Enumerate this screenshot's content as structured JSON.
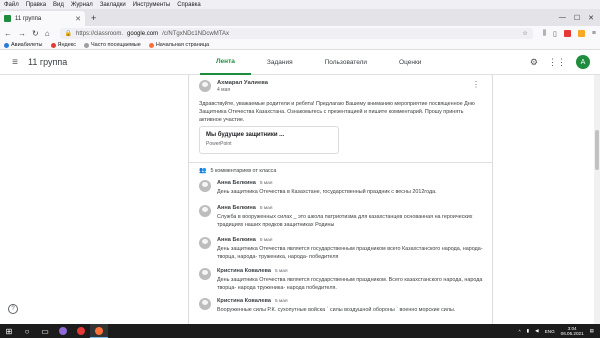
{
  "browser": {
    "menu": [
      "Файл",
      "Правка",
      "Вид",
      "Журнал",
      "Закладки",
      "Инструменты",
      "Справка"
    ],
    "tab_title": "11 группа",
    "url_prefix": "https://classroom.",
    "url_host": "google.com",
    "url_rest": "/c/NTgxNDc1NDcwMTAx",
    "bookmarks": [
      {
        "label": "Авиабилеты",
        "color": "#2b7bd6"
      },
      {
        "label": "Яндекс",
        "color": "#e53935"
      },
      {
        "label": "Часто посещаемые",
        "color": "#9e9e9e"
      },
      {
        "label": "Начальная страница",
        "color": "#ff7139"
      }
    ]
  },
  "classroom": {
    "class_name": "11 группа",
    "tabs": [
      "Лента",
      "Задания",
      "Пользователи",
      "Оценки"
    ],
    "active_tab": "Лента",
    "avatar_letter": "A",
    "accent": "#1e8e3e"
  },
  "post": {
    "author": "Ахмарал Уалиева",
    "date": "4 мая",
    "text": "Здравствуйте, уважаемые родители и ребята! Предлагаю Вашему вниманию мероприятие посвященное Дню Защитника Отечества Казахстана. Ознакомьтесь с презентацией и пишите комментарий. Прошу принять активное участие.",
    "attachment_title": "Мы будущие защитники ...",
    "attachment_type": "PowerPoint",
    "comments_count": "5 комментариев от класса"
  },
  "comments": [
    {
      "author": "Анна Белкина",
      "date": "5 мая",
      "text": "День защитника Отечества  в Казахстане, государственный праздник  с весны  2012года."
    },
    {
      "author": "Анна Белкина",
      "date": "5 мая",
      "text": "Служба  в вооруженных  силах _ это школа  патриотизма для казахстанцев основанная на героических традициях наших предков защитниках Родины"
    },
    {
      "author": "Анна Белкина",
      "date": "5 мая",
      "text": "День защитника Отечества является государственным праздником всего Казахстанского народа, народа- творца, народа- труженика, народа- победителя"
    },
    {
      "author": "Кристина Ковалева",
      "date": "5 мая",
      "text": "День защитника Отечества является государственным праздником.  Всего казахстанского народа, народа творца- народа труженика- народа победителя."
    },
    {
      "author": "Кристина Ковалева",
      "date": "5 мая",
      "text": "Вооруженные силы Р.К. сухопутные войска ` силы воздушной обороны ` военно морские силы."
    }
  ],
  "taskbar": {
    "time": "3:04",
    "date": "06.05.2021",
    "lang": "ENG"
  }
}
